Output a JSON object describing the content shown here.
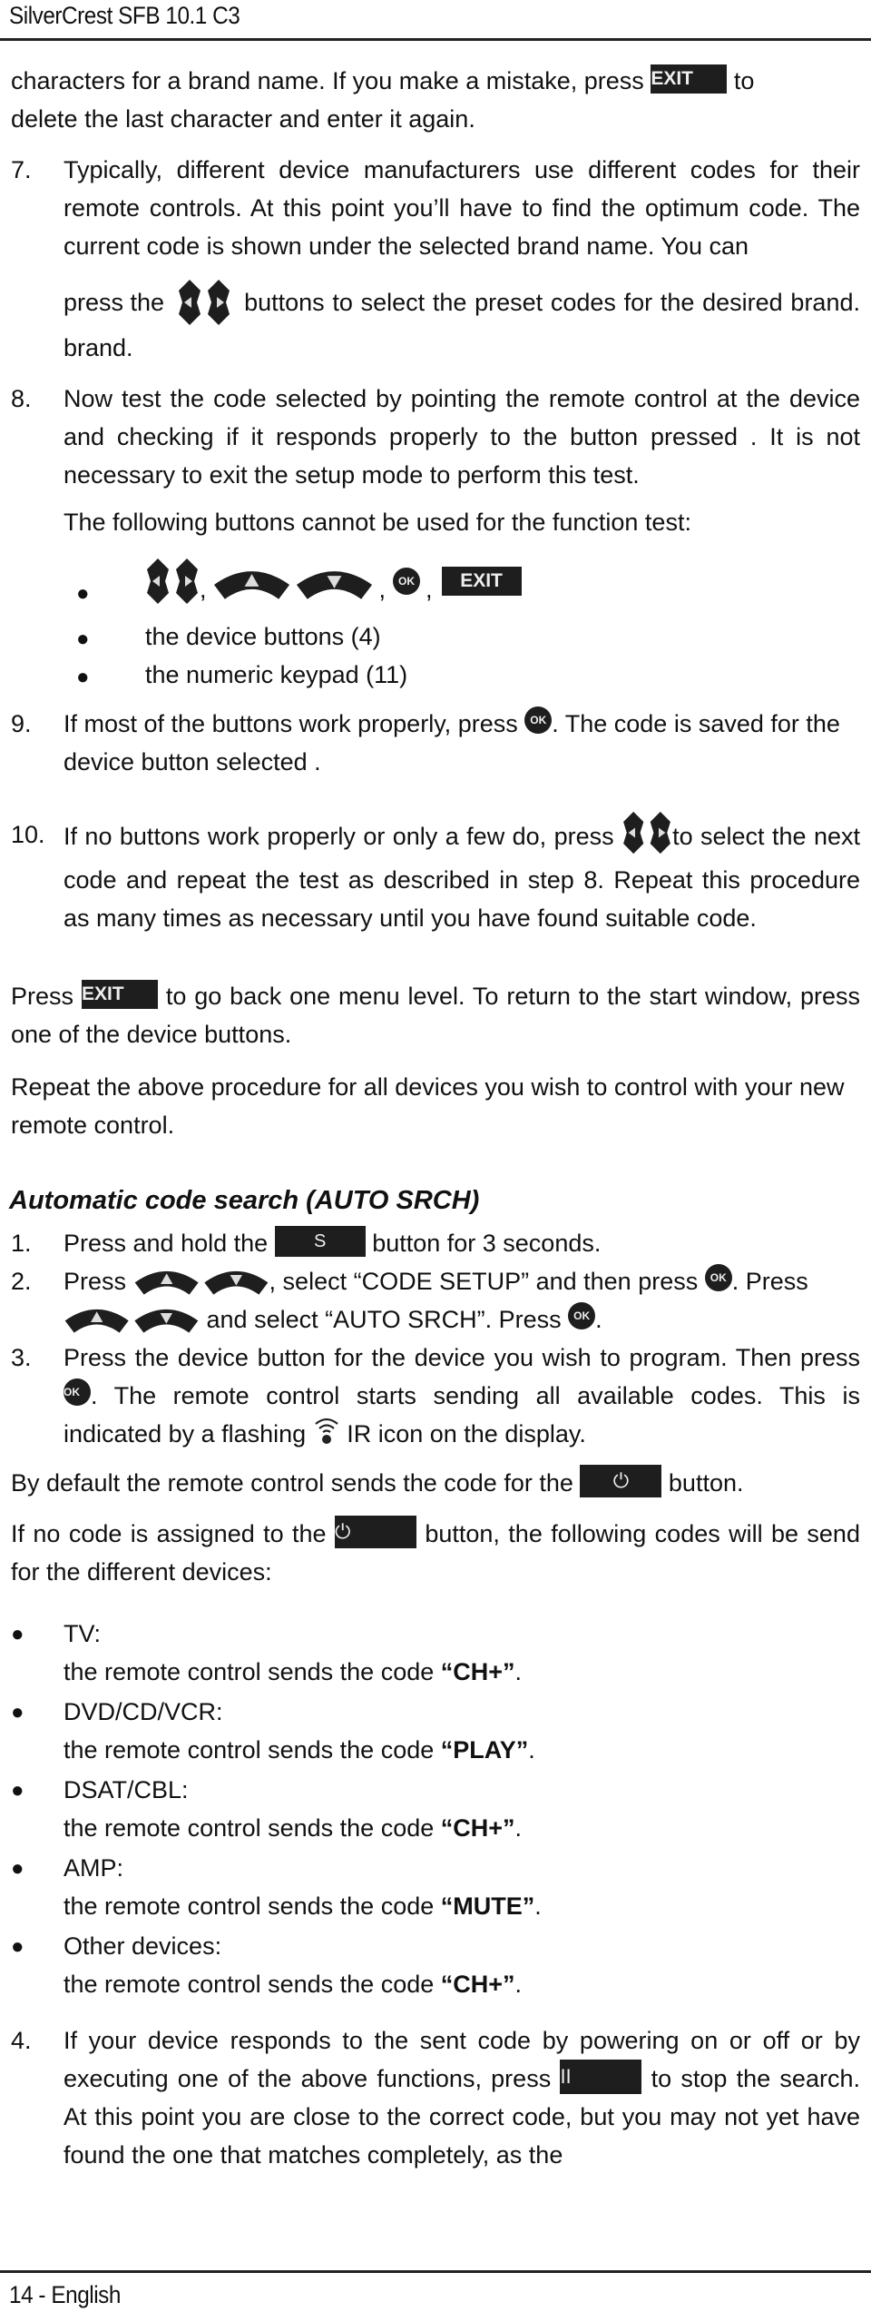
{
  "header": {
    "title": "SilverCrest SFB 10.1 C3"
  },
  "footer": {
    "page_label": "14 - English"
  },
  "buttons": {
    "exit": "EXIT",
    "ok": "OK",
    "s": "S",
    "power": "⏻",
    "pause": "II"
  },
  "intro": {
    "line1_a": "characters for a brand name. If you make a mistake, press",
    "line1_b": "to",
    "line2": "delete the last character and enter it again."
  },
  "step7": {
    "num": "7.",
    "text": "Typically, different device manufacturers use different codes for their remote controls. At this point you’ll have to find the optimum code. The current code is shown under the selected brand name. You can",
    "press_a": "press the",
    "press_b": "buttons to select the preset codes for the desired brand."
  },
  "step8": {
    "num": "8.",
    "text": "Now test the code selected by pointing the remote control at the device and checking if it responds properly to the button pressed . It is not necessary to exit the setup mode to perform this test.",
    "following": "The following buttons cannot be used for the function test:",
    "bullets": {
      "sep": ",",
      "device_buttons": "the device buttons (4)",
      "keypad": "the numeric keypad (11)"
    }
  },
  "step9": {
    "num": "9.",
    "a": "If most of the buttons work properly, press",
    "b": ". The code is saved for the device button selected ."
  },
  "step10": {
    "num": "10.",
    "a": "If no buttons work properly or only a few do, press",
    "b": "to select the next code and repeat the test as described in step 8. Repeat this procedure as many times as necessary until you have found suitable code."
  },
  "press_exit": {
    "a": "Press",
    "b": "to go back one menu level. To return to the start window, press one of the device buttons."
  },
  "repeat_text": "Repeat the above procedure for all devices you wish to control with your new remote control.",
  "auto": {
    "heading": "Automatic code search (AUTO SRCH)",
    "s1": {
      "num": "1.",
      "a": "Press and hold the",
      "b": "button for 3 seconds."
    },
    "s2": {
      "num": "2.",
      "a": "Press",
      "b": ", select “CODE SETUP” and then press",
      "c": ". Press",
      "d": "and select “AUTO SRCH”. Press",
      "e": "."
    },
    "s3": {
      "num": "3.",
      "a": "Press the device button for the device you wish to program. Then press",
      "b": ". The remote control starts sending all available codes. This is indicated by a flashing",
      "c": "IR icon on the display."
    },
    "default_a": "By default the remote control sends the code for the",
    "default_b": "button.",
    "noassign_a": "If no code is assigned to the",
    "noassign_b": "button, the following codes will be send for the different devices:",
    "sends_prefix": "the remote control sends the code",
    "devices": [
      {
        "name": "TV:",
        "code": "“CH+”"
      },
      {
        "name": "DVD/CD/VCR:",
        "code": "“PLAY”"
      },
      {
        "name": "DSAT/CBL:",
        "code": "“CH+”"
      },
      {
        "name": "AMP:",
        "code": "“MUTE”"
      },
      {
        "name": "Other devices:",
        "code": "“CH+”"
      }
    ],
    "s4": {
      "num": "4.",
      "a": "If your device responds to the sent code by powering on or off or by executing one of the above functions, press",
      "b": "to stop the search. At this point you are close to the correct code, but you may not yet have found the one that matches completely, as the"
    }
  }
}
